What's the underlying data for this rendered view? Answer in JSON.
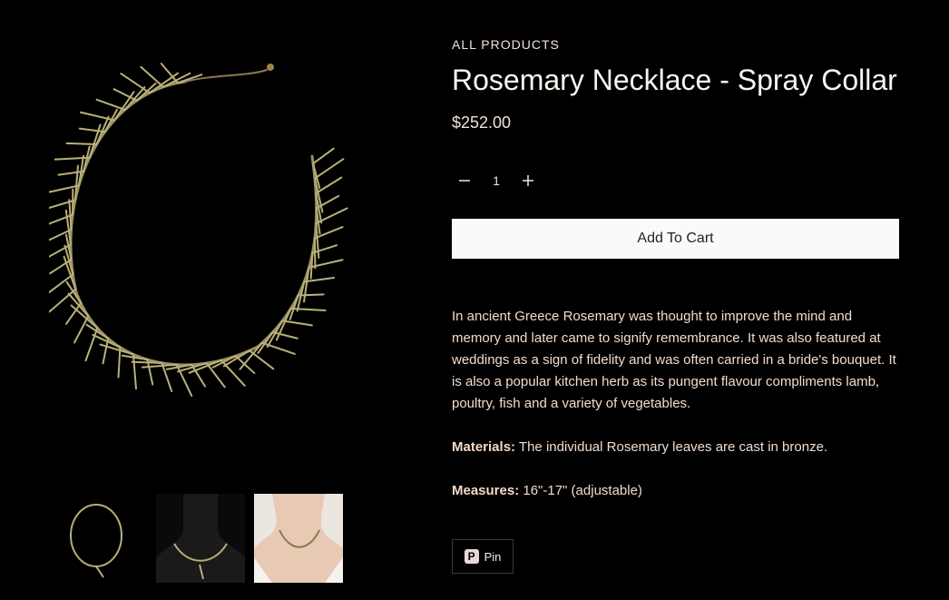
{
  "breadcrumb": "ALL PRODUCTS",
  "product": {
    "title": "Rosemary Necklace - Spray Collar",
    "price": "$252.00"
  },
  "quantity": {
    "value": "1",
    "minus_symbol": "−",
    "plus_symbol": "+"
  },
  "add_to_cart_label": "Add To Cart",
  "description": {
    "intro": "In ancient Greece Rosemary was thought to improve the mind and memory and later came to signify remembrance. It was also featured at weddings as a sign of fidelity and was often carried in a bride's bouquet. It is also a popular kitchen herb as its pungent flavour compliments lamb, poultry, fish and a variety of vegetables.",
    "materials_label": "Materials:",
    "materials_text": " The individual Rosemary leaves are cast in bronze.",
    "measures_label": "Measures:",
    "measures_text": " 16\"-17\" (adjustable)"
  },
  "share": {
    "pin_label": "Pin",
    "pin_icon": "pinterest-icon"
  },
  "gallery": {
    "thumbnail_count": 3
  }
}
